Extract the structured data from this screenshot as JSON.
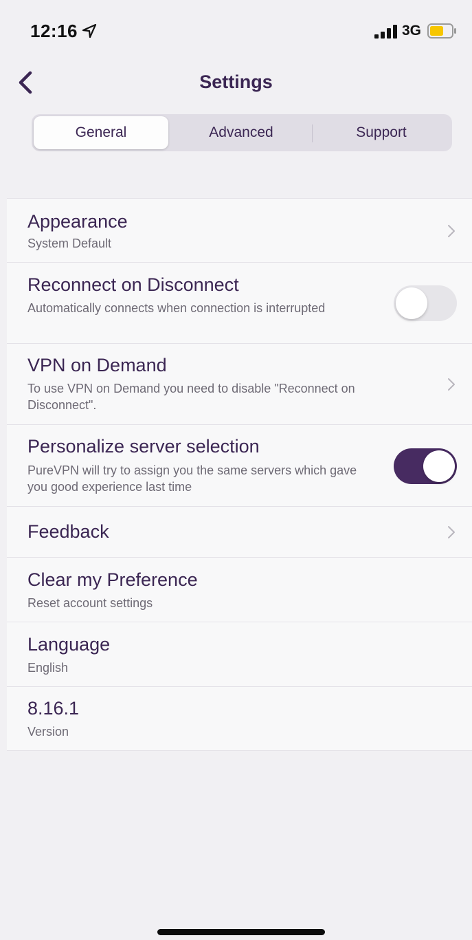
{
  "status_bar": {
    "time": "12:16",
    "network": "3G",
    "battery_color": "#f7c600"
  },
  "nav": {
    "title": "Settings"
  },
  "tabs": [
    {
      "label": "General",
      "active": true
    },
    {
      "label": "Advanced",
      "active": false
    },
    {
      "label": "Support",
      "active": false
    }
  ],
  "settings": {
    "appearance": {
      "title": "Appearance",
      "subtitle": "System Default"
    },
    "reconnect": {
      "title": "Reconnect on Disconnect",
      "subtitle": "Automatically connects when connection is interrupted",
      "enabled": false
    },
    "vpn_on_demand": {
      "title": "VPN on Demand",
      "subtitle": "To use VPN on Demand you need to disable \"Reconnect on Disconnect\"."
    },
    "personalize": {
      "title": "Personalize server selection",
      "subtitle": "PureVPN will try to assign you the same servers which gave you good experience last time",
      "enabled": true
    },
    "feedback": {
      "title": "Feedback"
    },
    "clear_preference": {
      "title": "Clear my Preference",
      "subtitle": "Reset account settings"
    },
    "language": {
      "title": "Language",
      "subtitle": "English"
    },
    "version": {
      "title": "8.16.1",
      "subtitle": "Version"
    }
  },
  "colors": {
    "accent": "#472b61",
    "title_text": "#3b2653",
    "subtitle_text": "#6e6a75"
  }
}
